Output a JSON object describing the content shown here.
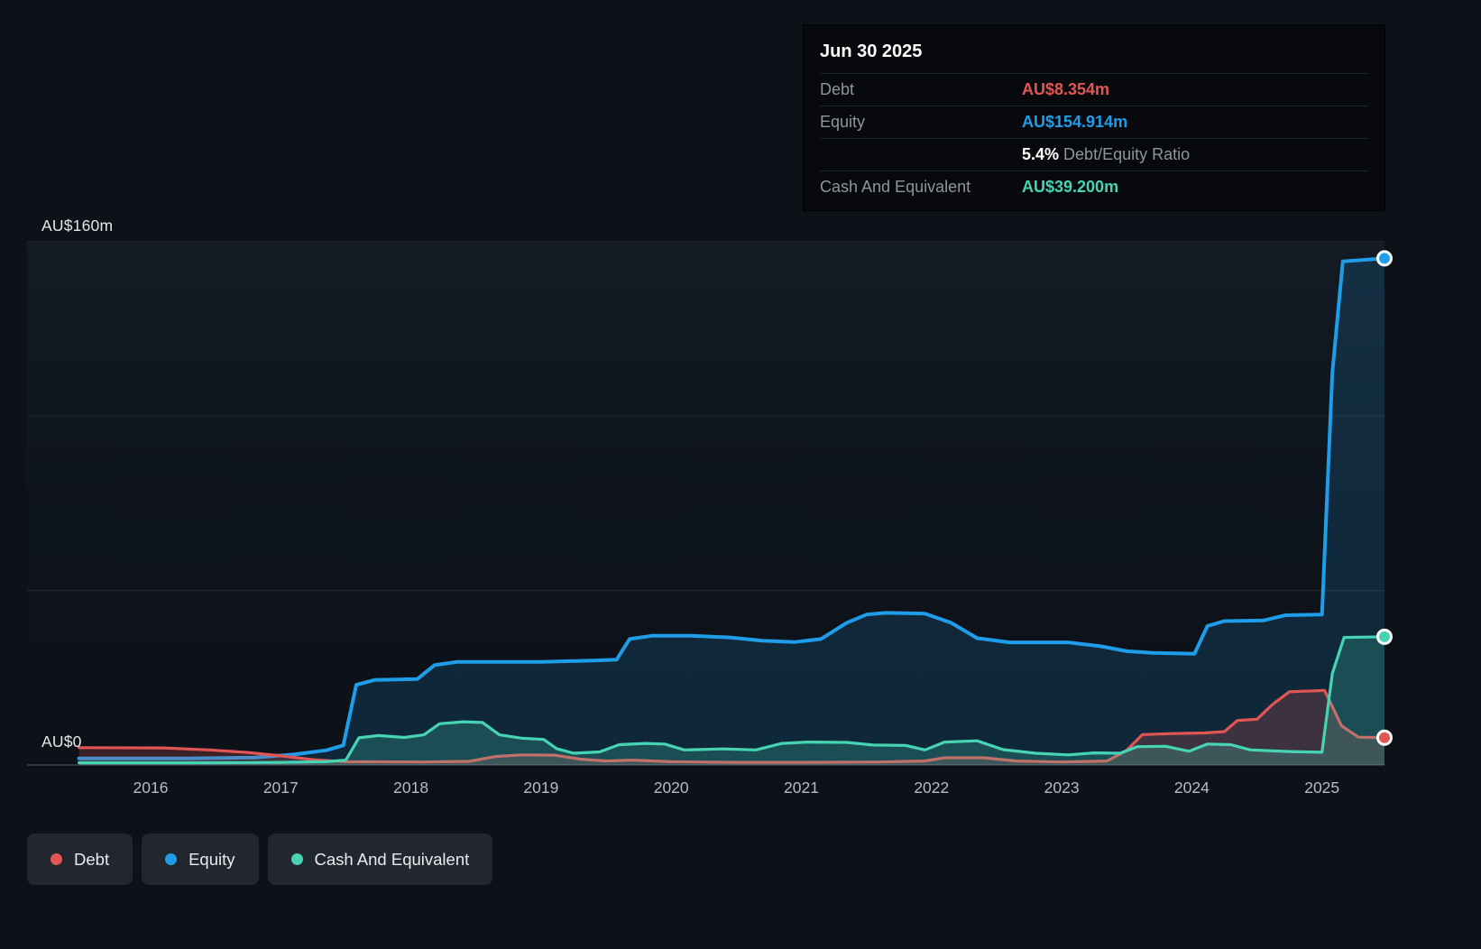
{
  "tooltip": {
    "date": "Jun 30 2025",
    "debt_label": "Debt",
    "debt_value": "AU$8.354m",
    "equity_label": "Equity",
    "equity_value": "AU$154.914m",
    "ratio_value": "5.4%",
    "ratio_label": "Debt/Equity Ratio",
    "cash_label": "Cash And Equivalent",
    "cash_value": "AU$39.200m"
  },
  "legend": [
    {
      "label": "Debt",
      "color": "#e25555"
    },
    {
      "label": "Equity",
      "color": "#1f9de8"
    },
    {
      "label": "Cash And Equivalent",
      "color": "#46d4b4"
    }
  ],
  "chart_data": {
    "type": "area",
    "ylabel": "AU$ millions",
    "ylim": [
      0,
      160
    ],
    "y_axis_labels": {
      "max": "AU$160m",
      "zero": "AU$0"
    },
    "x_ticks": [
      "2016",
      "2017",
      "2018",
      "2019",
      "2020",
      "2021",
      "2022",
      "2023",
      "2024",
      "2025"
    ],
    "grid_values": [
      160,
      106.7,
      53.3
    ],
    "legend_position": "bottom-left",
    "series": [
      {
        "name": "Equity",
        "color": "#1f9de8",
        "points": [
          [
            2015.45,
            2.0
          ],
          [
            2016.3,
            2.0
          ],
          [
            2016.8,
            2.3
          ],
          [
            2017.1,
            3.2
          ],
          [
            2017.35,
            4.5
          ],
          [
            2017.48,
            6.0
          ],
          [
            2017.58,
            24.5
          ],
          [
            2017.72,
            26.0
          ],
          [
            2018.05,
            26.3
          ],
          [
            2018.18,
            30.5
          ],
          [
            2018.35,
            31.5
          ],
          [
            2019.0,
            31.5
          ],
          [
            2019.45,
            32.0
          ],
          [
            2019.58,
            32.2
          ],
          [
            2019.68,
            38.5
          ],
          [
            2019.85,
            39.5
          ],
          [
            2020.15,
            39.5
          ],
          [
            2020.45,
            39.0
          ],
          [
            2020.7,
            38.0
          ],
          [
            2020.95,
            37.6
          ],
          [
            2021.15,
            38.5
          ],
          [
            2021.35,
            43.5
          ],
          [
            2021.5,
            46.0
          ],
          [
            2021.65,
            46.5
          ],
          [
            2021.95,
            46.3
          ],
          [
            2022.15,
            43.5
          ],
          [
            2022.35,
            38.8
          ],
          [
            2022.6,
            37.5
          ],
          [
            2023.05,
            37.5
          ],
          [
            2023.3,
            36.3
          ],
          [
            2023.5,
            34.8
          ],
          [
            2023.7,
            34.3
          ],
          [
            2024.02,
            34.0
          ],
          [
            2024.12,
            42.5
          ],
          [
            2024.25,
            44.0
          ],
          [
            2024.55,
            44.2
          ],
          [
            2024.72,
            45.8
          ],
          [
            2025.0,
            46.0
          ],
          [
            2025.08,
            120.0
          ],
          [
            2025.16,
            154.0
          ],
          [
            2025.48,
            154.914
          ]
        ]
      },
      {
        "name": "Debt",
        "color": "#e25555",
        "points": [
          [
            2015.45,
            5.3
          ],
          [
            2016.1,
            5.2
          ],
          [
            2016.45,
            4.6
          ],
          [
            2016.75,
            3.8
          ],
          [
            2017.0,
            2.8
          ],
          [
            2017.25,
            1.6
          ],
          [
            2017.5,
            1.0
          ],
          [
            2018.1,
            0.9
          ],
          [
            2018.45,
            1.1
          ],
          [
            2018.65,
            2.6
          ],
          [
            2018.85,
            3.1
          ],
          [
            2019.1,
            3.0
          ],
          [
            2019.3,
            1.8
          ],
          [
            2019.5,
            1.2
          ],
          [
            2019.7,
            1.5
          ],
          [
            2020.0,
            1.0
          ],
          [
            2020.5,
            0.8
          ],
          [
            2021.0,
            0.8
          ],
          [
            2021.6,
            0.9
          ],
          [
            2021.95,
            1.2
          ],
          [
            2022.1,
            2.2
          ],
          [
            2022.4,
            2.2
          ],
          [
            2022.65,
            1.2
          ],
          [
            2023.0,
            0.9
          ],
          [
            2023.35,
            1.2
          ],
          [
            2023.5,
            4.5
          ],
          [
            2023.62,
            9.3
          ],
          [
            2023.85,
            9.6
          ],
          [
            2024.1,
            9.8
          ],
          [
            2024.25,
            10.2
          ],
          [
            2024.35,
            13.6
          ],
          [
            2024.5,
            14.0
          ],
          [
            2024.62,
            18.5
          ],
          [
            2024.75,
            22.4
          ],
          [
            2025.02,
            22.8
          ],
          [
            2025.15,
            12.0
          ],
          [
            2025.28,
            8.5
          ],
          [
            2025.48,
            8.354
          ]
        ]
      },
      {
        "name": "Cash And Equivalent",
        "color": "#46d4b4",
        "points": [
          [
            2015.45,
            0.7
          ],
          [
            2016.5,
            0.7
          ],
          [
            2017.0,
            0.8
          ],
          [
            2017.35,
            1.0
          ],
          [
            2017.5,
            1.5
          ],
          [
            2017.6,
            8.3
          ],
          [
            2017.75,
            9.0
          ],
          [
            2017.95,
            8.4
          ],
          [
            2018.1,
            9.2
          ],
          [
            2018.22,
            12.6
          ],
          [
            2018.4,
            13.2
          ],
          [
            2018.55,
            13.0
          ],
          [
            2018.68,
            9.2
          ],
          [
            2018.85,
            8.2
          ],
          [
            2019.02,
            7.8
          ],
          [
            2019.12,
            5.0
          ],
          [
            2019.25,
            3.6
          ],
          [
            2019.45,
            4.0
          ],
          [
            2019.6,
            6.2
          ],
          [
            2019.8,
            6.6
          ],
          [
            2019.95,
            6.4
          ],
          [
            2020.1,
            4.6
          ],
          [
            2020.4,
            4.9
          ],
          [
            2020.65,
            4.6
          ],
          [
            2020.85,
            6.6
          ],
          [
            2021.05,
            7.0
          ],
          [
            2021.35,
            6.9
          ],
          [
            2021.55,
            6.1
          ],
          [
            2021.8,
            6.0
          ],
          [
            2021.95,
            4.6
          ],
          [
            2022.1,
            7.0
          ],
          [
            2022.35,
            7.4
          ],
          [
            2022.55,
            4.7
          ],
          [
            2022.8,
            3.6
          ],
          [
            2023.05,
            3.1
          ],
          [
            2023.25,
            3.7
          ],
          [
            2023.45,
            3.6
          ],
          [
            2023.58,
            5.6
          ],
          [
            2023.8,
            5.7
          ],
          [
            2023.98,
            4.2
          ],
          [
            2024.12,
            6.4
          ],
          [
            2024.3,
            6.2
          ],
          [
            2024.45,
            4.6
          ],
          [
            2024.75,
            4.1
          ],
          [
            2025.0,
            3.9
          ],
          [
            2025.08,
            28.0
          ],
          [
            2025.17,
            39.0
          ],
          [
            2025.48,
            39.2
          ]
        ]
      }
    ]
  }
}
